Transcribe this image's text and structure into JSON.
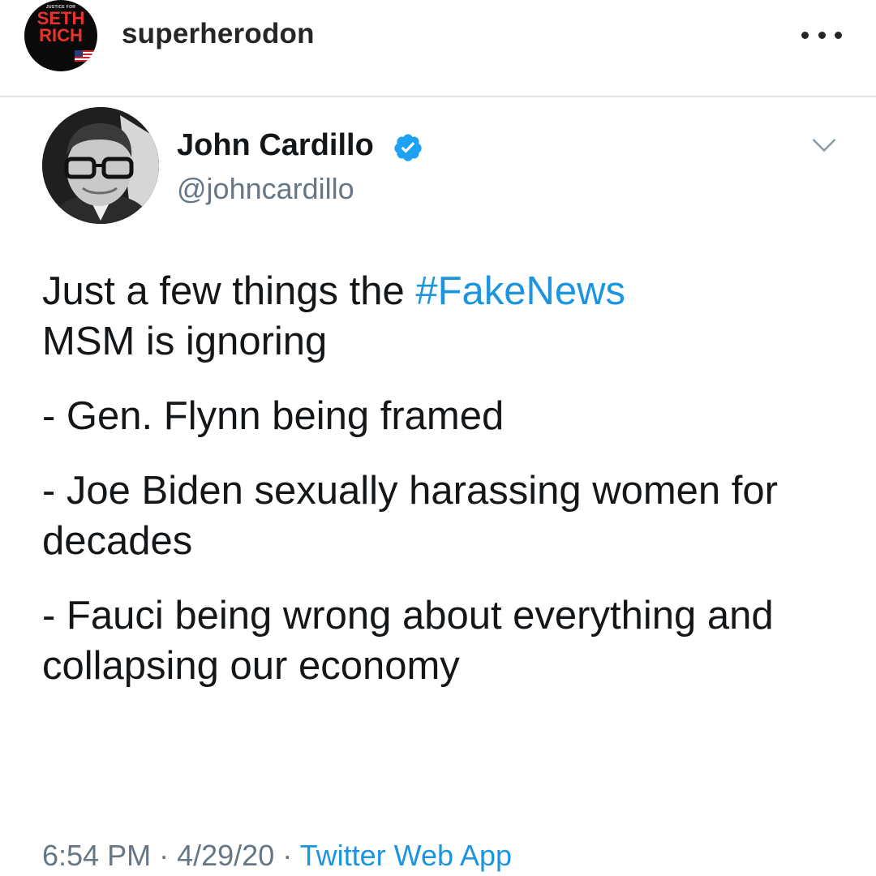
{
  "instagram": {
    "username": "superherodon",
    "avatar_small_text": "JUSTICE FOR",
    "avatar_line1": "SETH",
    "avatar_line2": "RICH",
    "more_icon": "more-horizontal-icon"
  },
  "tweet": {
    "author_name": "John Cardillo",
    "author_handle": "@johncardillo",
    "verified_icon": "verified-badge-icon",
    "caret_icon": "chevron-down-icon",
    "text_intro_prefix": "Just a few things the ",
    "hashtag": "#FakeNews",
    "text_intro_suffix": "MSM is ignoring",
    "items": [
      "- Gen. Flynn being framed",
      "- Joe Biden sexually harassing women for decades",
      "- Fauci being wrong about everything and collapsing our economy"
    ],
    "time": "6:54 PM",
    "separator": "·",
    "date": "4/29/20",
    "source": "Twitter Web App"
  },
  "colors": {
    "link": "#1b95e0",
    "secondary_text": "#657786",
    "primary_text": "#14171a",
    "avatar_red": "#e8322c"
  }
}
